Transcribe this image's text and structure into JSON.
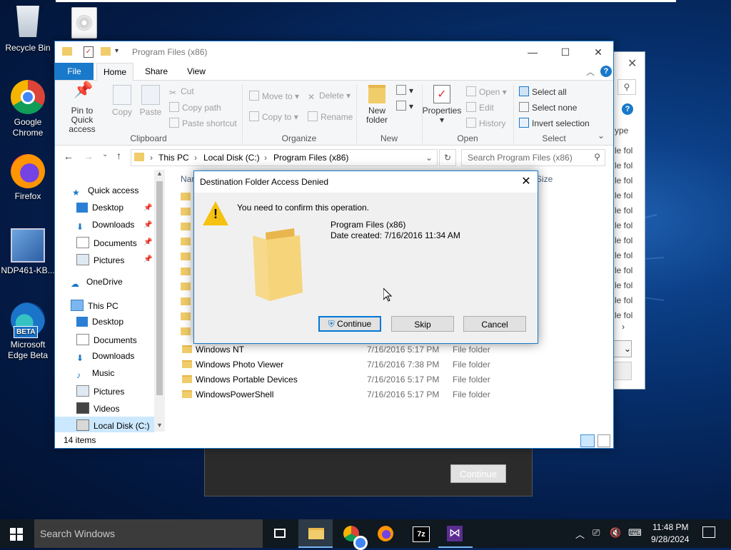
{
  "desktop": {
    "icons": [
      {
        "label": "Recycle Bin"
      },
      {
        "label": "Google Chrome"
      },
      {
        "label": "Firefox"
      },
      {
        "label": "NDP461-KB..."
      },
      {
        "label": "Microsoft Edge Beta",
        "badge": "BETA"
      }
    ]
  },
  "explorer": {
    "title": "Program Files (x86)",
    "tabs": {
      "file": "File",
      "home": "Home",
      "share": "Share",
      "view": "View"
    },
    "ribbon": {
      "clipboard": {
        "label": "Clipboard",
        "pin": "Pin to Quick access",
        "copy": "Copy",
        "paste": "Paste",
        "cut": "Cut",
        "copy_path": "Copy path",
        "paste_shortcut": "Paste shortcut"
      },
      "organize": {
        "label": "Organize",
        "move_to": "Move to",
        "copy_to": "Copy to",
        "delete": "Delete",
        "rename": "Rename"
      },
      "new": {
        "label": "New",
        "new_folder": "New folder"
      },
      "open": {
        "label": "Open",
        "properties": "Properties",
        "open": "Open",
        "edit": "Edit",
        "history": "History"
      },
      "select": {
        "label": "Select",
        "select_all": "Select all",
        "select_none": "Select none",
        "invert": "Invert selection"
      }
    },
    "address": {
      "this_pc": "This PC",
      "disk": "Local Disk (C:)",
      "folder": "Program Files (x86)"
    },
    "search_placeholder": "Search Program Files (x86)",
    "columns": {
      "name": "Nar",
      "size": "Size"
    },
    "nav": {
      "quick_access": "Quick access",
      "qa_items": [
        "Desktop",
        "Downloads",
        "Documents",
        "Pictures"
      ],
      "onedrive": "OneDrive",
      "this_pc": "This PC",
      "pc_items": [
        "Desktop",
        "Documents",
        "Downloads",
        "Music",
        "Pictures",
        "Videos",
        "Local Disk (C:)"
      ]
    },
    "files": [
      {
        "name": "Windows NT",
        "date": "7/16/2016 5:17 PM",
        "type": "File folder"
      },
      {
        "name": "Windows Photo Viewer",
        "date": "7/16/2016 7:38 PM",
        "type": "File folder"
      },
      {
        "name": "Windows Portable Devices",
        "date": "7/16/2016 5:17 PM",
        "type": "File folder"
      },
      {
        "name": "WindowsPowerShell",
        "date": "7/16/2016 5:17 PM",
        "type": "File folder"
      }
    ],
    "status": "14 items"
  },
  "background_window": {
    "col_header": "ype",
    "row_text": "le fol"
  },
  "dialog": {
    "title": "Destination Folder Access Denied",
    "message": "You need to confirm this operation.",
    "folder_name": "Program Files (x86)",
    "date_created": "Date created: 7/16/2016 11:34 AM",
    "buttons": {
      "continue": "Continue",
      "skip": "Skip",
      "cancel": "Cancel"
    }
  },
  "installer": {
    "continue": "Continue"
  },
  "taskbar": {
    "search_placeholder": "Search Windows",
    "time": "11:48 PM",
    "date": "9/28/2024"
  },
  "colors": {
    "accent": "#1979ca",
    "file_tab": "#1979ca",
    "warning": "#f5c211",
    "folder": "#f0cc6a"
  }
}
